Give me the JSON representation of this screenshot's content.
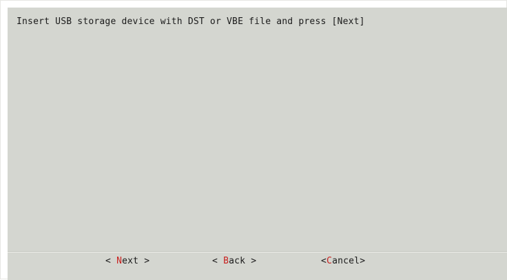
{
  "dialog": {
    "message": "Insert USB storage device with DST or VBE file and press [Next]"
  },
  "buttons": {
    "next": {
      "prefix": "< ",
      "hotkey": "N",
      "rest": "ext",
      "suffix": " >"
    },
    "back": {
      "prefix": "< ",
      "hotkey": "B",
      "rest": "ack",
      "suffix": " >"
    },
    "cancel": {
      "prefix": "<",
      "hotkey": "C",
      "rest": "ancel",
      "suffix": ">"
    }
  },
  "colors": {
    "dialog_background": "#d4d6d0",
    "hotkey": "#c8201e",
    "text": "#1a1a1a"
  }
}
